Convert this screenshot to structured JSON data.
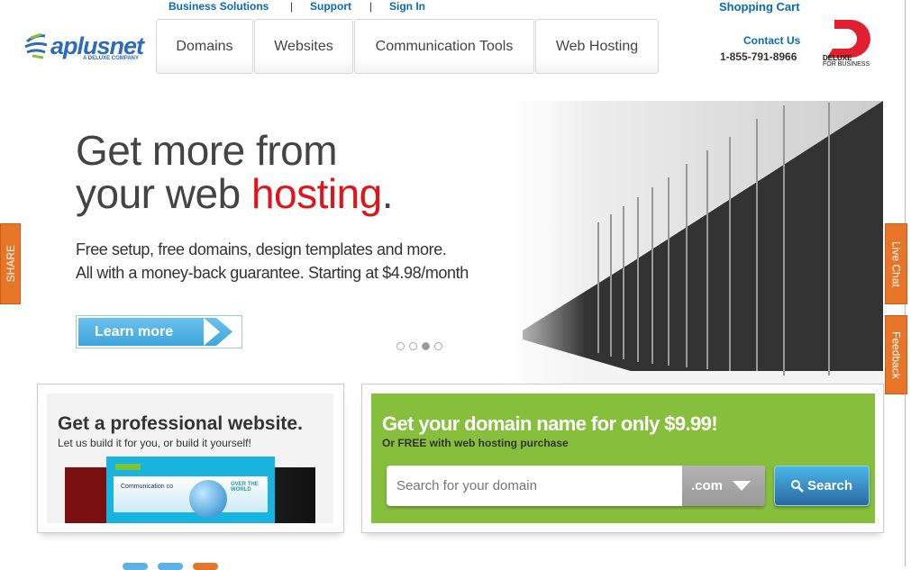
{
  "header": {
    "top_links": [
      "Business Solutions",
      "Support",
      "Sign In"
    ],
    "separator": "|",
    "shopping_cart": "Shopping Cart",
    "contact_us": "Contact Us",
    "phone": "1-855-791-8966",
    "logo_text": "aplusnet",
    "logo_tagline": "A DELUXE COMPANY",
    "deluxe_logo": {
      "name": "DELUXE",
      "tagline": "FOR BUSINESS"
    }
  },
  "nav": {
    "tabs": [
      "Domains",
      "Websites",
      "Communication Tools",
      "Web Hosting"
    ]
  },
  "hero": {
    "headline_line1": "Get more from",
    "headline_line2_prefix": "your web ",
    "headline_highlight": "hosting",
    "headline_suffix": ".",
    "subtext_line1": "Free setup, free domains, design templates and more.",
    "subtext_line2": "All with a money-back guarantee. Starting at $4.98/month",
    "cta": "Learn more",
    "slides": 4,
    "active_slide": 3
  },
  "side_tabs": {
    "share": "SHARE",
    "live_chat": "Live Chat",
    "feedback": "Feedback"
  },
  "website_promo": {
    "title": "Get a professional website.",
    "subtitle": "Let us build it for you, or build it yourself!",
    "screenshot_text": "Communication co",
    "screenshot_tagline": "OVER THE WORLD"
  },
  "domain_promo": {
    "title": "Get your domain name for only $9.99!",
    "subtitle": "Or FREE with web hosting purchase",
    "search_placeholder": "Search for your domain",
    "tld_selected": ".com",
    "search_button": "Search"
  },
  "colors": {
    "brand_blue": "#0a6ab8",
    "accent_red": "#e0141b",
    "green": "#86bf3c",
    "orange": "#e6752a"
  }
}
